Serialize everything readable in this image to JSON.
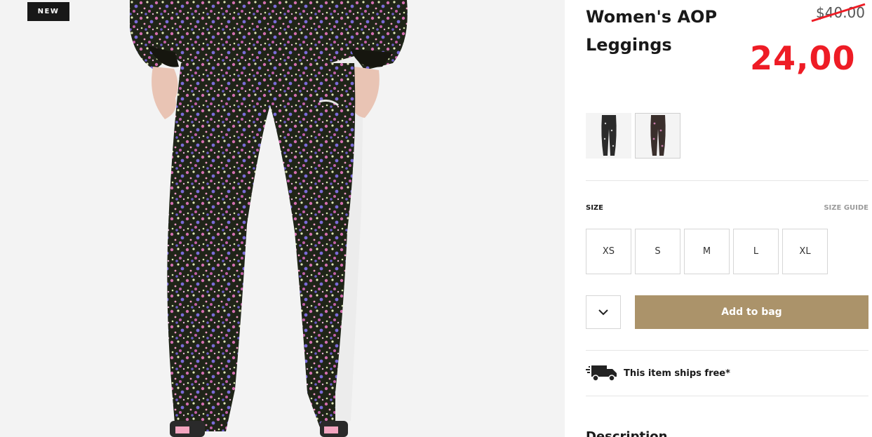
{
  "badge": {
    "text": "NEW"
  },
  "product": {
    "title": "Women's AOP Leggings",
    "old_price": "$40.00",
    "new_price": "24,00"
  },
  "swatches": [
    {
      "name": "black-print",
      "selected": false
    },
    {
      "name": "dark-print",
      "selected": true
    }
  ],
  "size": {
    "label": "SIZE",
    "guide": "SIZE GUIDE",
    "options": [
      "XS",
      "S",
      "M",
      "L",
      "XL"
    ]
  },
  "cart": {
    "add_label": "Add to bag",
    "quantity_icon": "chevron-down-icon"
  },
  "shipping": {
    "text": "This item ships free*",
    "icon": "delivery-truck-icon"
  },
  "description": {
    "heading": "Description"
  },
  "colors": {
    "accent": "#ab936a",
    "sale_price": "#ee1c25",
    "badge_bg": "#181818"
  }
}
